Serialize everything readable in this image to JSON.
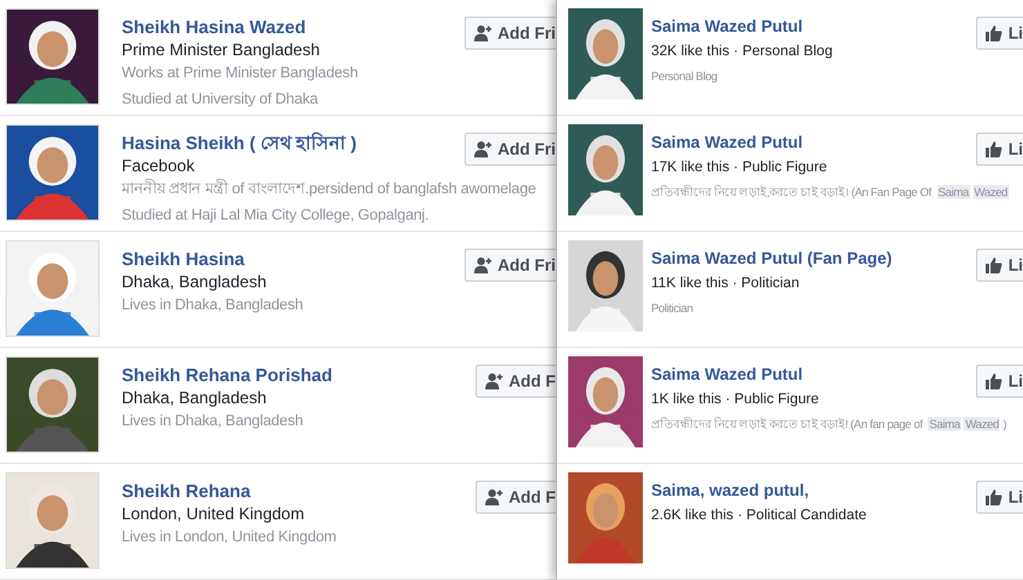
{
  "people": [
    {
      "name": "Sheikh Hasina Wazed",
      "lines": [
        {
          "text": "Prime Minister Bangladesh",
          "kind": "primary"
        },
        {
          "text": "Works at Prime Minister Bangladesh",
          "kind": "secondary"
        },
        {
          "text": "Studied at University of Dhaka",
          "kind": "secondary"
        }
      ],
      "button": "Add Fri",
      "picture": {
        "kind": "picture"
      }
    },
    {
      "name": "Hasina Sheikh ( সেথ হাসিনা )",
      "lines": [
        {
          "text": "Facebook",
          "kind": "primary"
        },
        {
          "text": "মাননীয় প্রধান মন্ত্রী of বাংলাদেশ.persidend of banglafsh awomelage",
          "kind": "secondary"
        },
        {
          "text": "Studied at Haji Lal Mia City College, Gopalganj.",
          "kind": "secondary"
        }
      ],
      "button": "Add Fri",
      "picture": {
        "kind": "picture"
      }
    },
    {
      "name": "Sheikh Hasina",
      "lines": [
        {
          "text": "Dhaka, Bangladesh",
          "kind": "primary"
        },
        {
          "text": "Lives in Dhaka, Bangladesh",
          "kind": "secondary"
        }
      ],
      "button": "Add Fri",
      "picture": {
        "kind": "picture"
      }
    },
    {
      "name": "Sheikh Rehana Porishad",
      "lines": [
        {
          "text": "Dhaka, Bangladesh",
          "kind": "primary"
        },
        {
          "text": "Lives in Dhaka, Bangladesh",
          "kind": "secondary"
        }
      ],
      "button": "Add F",
      "picture": {
        "kind": "picture"
      }
    },
    {
      "name": "Sheikh Rehana",
      "lines": [
        {
          "text": "London, United Kingdom",
          "kind": "primary"
        },
        {
          "text": "Lives in London, United Kingdom",
          "kind": "secondary"
        }
      ],
      "button": "Add F",
      "picture": {
        "kind": "picture"
      }
    }
  ],
  "pages": [
    {
      "name": "Saima Wazed Putul",
      "stats": "32K like this · Personal Blog",
      "description": [
        {
          "text": "Personal Blog",
          "highlighted": false
        }
      ],
      "button": "Li",
      "picture": {
        "kind": "picture"
      }
    },
    {
      "name": "Saima Wazed Putul",
      "stats": "17K like this · Public Figure",
      "description": [
        {
          "text": "প্রতিবন্ধীদের নিয়ে লড়াই,করতে চাই বড়াই। (An Fan Page Of ",
          "highlighted": false
        },
        {
          "text": "Saima",
          "highlighted": true
        },
        {
          "text": "Wazed",
          "highlighted": true
        }
      ],
      "button": "Li",
      "picture": {
        "kind": "picture"
      }
    },
    {
      "name": "Saima Wazed Putul (Fan Page)",
      "stats": "11K like this · Politician",
      "description": [
        {
          "text": "Politician",
          "highlighted": false
        }
      ],
      "button": "Li",
      "picture": {
        "kind": "picture"
      }
    },
    {
      "name": "Saima Wazed Putul",
      "stats": "1K like this · Public Figure",
      "description": [
        {
          "text": "প্রতিবন্ধীদের নিয়ে লড়াই করতে চাই বড়াই! (An fan page of ",
          "highlighted": false
        },
        {
          "text": "Saima",
          "highlighted": true
        },
        {
          "text": "Wazed",
          "highlighted": true
        },
        {
          "text": ")",
          "highlighted": false
        }
      ],
      "button": "Li",
      "picture": {
        "kind": "picture"
      }
    },
    {
      "name": "Saima, wazed putul,",
      "stats": "2.6K like this · Political Candidate",
      "button": "Li",
      "picture": {
        "kind": "picture"
      }
    }
  ]
}
